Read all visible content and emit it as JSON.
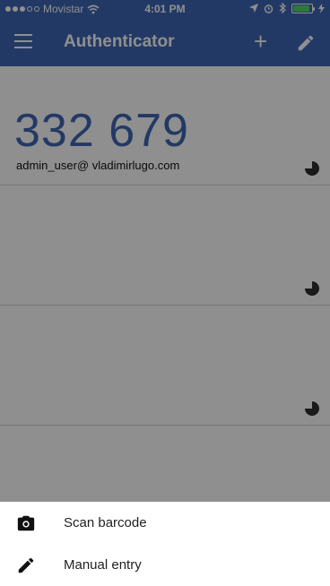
{
  "status_bar": {
    "carrier": "Movistar",
    "time": "4:01 PM",
    "signal_dots_filled": 3,
    "signal_dots_total": 5,
    "battery_level": 0.9
  },
  "app_bar": {
    "title": "Authenticator",
    "menu_icon": "menu-icon",
    "add_icon": "add-icon",
    "edit_icon": "pencil-icon"
  },
  "accounts": [
    {
      "code": "332 679",
      "name": "admin_user@ vladimirlugo.com",
      "time_remaining_fraction": 0.75
    },
    {
      "code": "",
      "name": "",
      "time_remaining_fraction": 0.75
    },
    {
      "code": "",
      "name": "",
      "time_remaining_fraction": 0.75
    }
  ],
  "bottom_sheet": {
    "items": [
      {
        "label": "Scan barcode",
        "icon": "camera-icon"
      },
      {
        "label": "Manual entry",
        "icon": "pencil-icon"
      }
    ]
  },
  "colors": {
    "primary": "#3f67b4",
    "battery": "#4cd964"
  }
}
